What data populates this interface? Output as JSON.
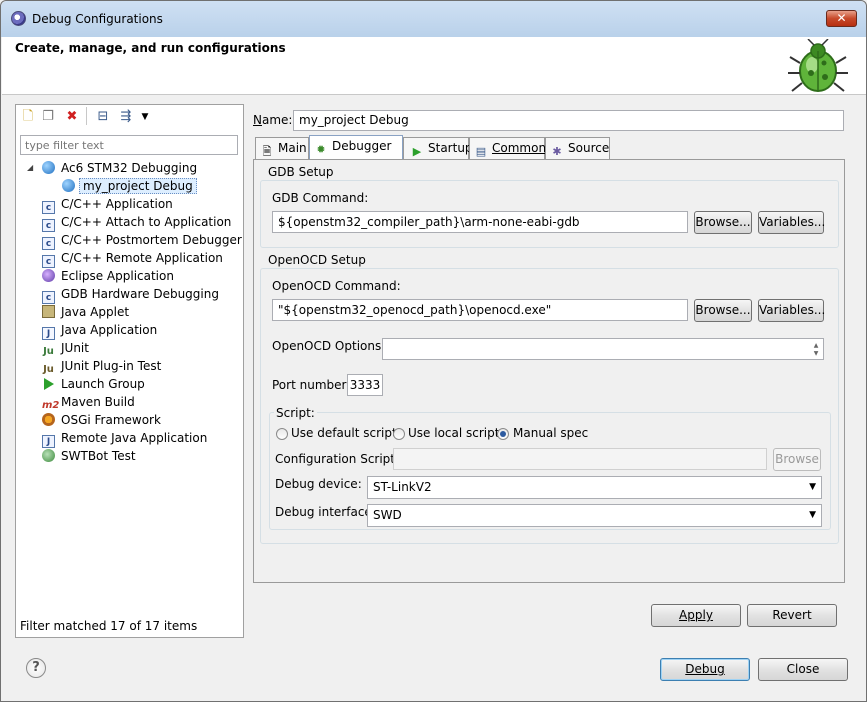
{
  "window": {
    "title": "Debug Configurations",
    "close_glyph": "✕"
  },
  "header": {
    "title": "Create, manage, and run configurations",
    "icon": "bug-icon"
  },
  "left": {
    "toolbar": [
      "new-config-icon",
      "duplicate-icon",
      "delete-icon",
      "collapse-all-icon",
      "filter-icon",
      "dropdown-icon"
    ],
    "filter_placeholder": "type filter text",
    "tree": {
      "root": "Ac6 STM32 Debugging",
      "selected": "my_project Debug",
      "items": [
        {
          "label": "C/C++ Application",
          "icon": "c-app-icon"
        },
        {
          "label": "C/C++ Attach to Application",
          "icon": "c-app-icon"
        },
        {
          "label": "C/C++ Postmortem Debugger",
          "icon": "c-app-icon"
        },
        {
          "label": "C/C++ Remote Application",
          "icon": "c-app-icon"
        },
        {
          "label": "Eclipse Application",
          "icon": "eclipse-icon"
        },
        {
          "label": "GDB Hardware Debugging",
          "icon": "c-app-icon"
        },
        {
          "label": "Java Applet",
          "icon": "applet-icon"
        },
        {
          "label": "Java Application",
          "icon": "java-app-icon"
        },
        {
          "label": "JUnit",
          "icon": "junit-icon"
        },
        {
          "label": "JUnit Plug-in Test",
          "icon": "junit-plugin-icon"
        },
        {
          "label": "Launch Group",
          "icon": "launch-group-icon"
        },
        {
          "label": "Maven Build",
          "icon": "maven-icon"
        },
        {
          "label": "OSGi Framework",
          "icon": "osgi-icon"
        },
        {
          "label": "Remote Java Application",
          "icon": "remote-java-icon"
        },
        {
          "label": "SWTBot Test",
          "icon": "swtbot-icon"
        }
      ]
    },
    "status": "Filter matched 17 of 17 items"
  },
  "right": {
    "name_label_u": "N",
    "name_label_rest": "ame:",
    "name_value": "my_project Debug",
    "tabs": [
      {
        "label": "Main",
        "icon": "main-tab-icon"
      },
      {
        "label": "Debugger",
        "icon": "debugger-tab-icon",
        "active": true
      },
      {
        "label": "Startup",
        "icon": "startup-tab-icon"
      },
      {
        "label": "Common",
        "icon": "common-tab-icon"
      },
      {
        "label": "Source",
        "icon": "source-tab-icon"
      }
    ],
    "gdb": {
      "group_title": "GDB Setup",
      "command_label": "GDB Command:",
      "command_value": "${openstm32_compiler_path}\\arm-none-eabi-gdb",
      "browse": "Browse...",
      "variables": "Variables..."
    },
    "openocd": {
      "group_title": "OpenOCD Setup",
      "command_label": "OpenOCD Command:",
      "command_value": "\"${openstm32_openocd_path}\\openocd.exe\"",
      "browse": "Browse...",
      "variables": "Variables...",
      "options_label": "OpenOCD Options :",
      "options_value": "",
      "port_label": "Port number:",
      "port_value": "3333"
    },
    "script": {
      "group_title": "Script:",
      "radio_default": "Use default script",
      "radio_local": "Use local script",
      "radio_manual": "Manual spec",
      "selected": "manual",
      "config_label": "Configuration Script:",
      "config_value": "",
      "config_browse": "Browse",
      "device_label": "Debug device:",
      "device_value": "ST-LinkV2",
      "interface_label": "Debug interface:",
      "interface_value": "SWD"
    },
    "apply": "Apply",
    "revert": "Revert"
  },
  "footer": {
    "help": "?",
    "debug": "Debug",
    "close": "Close"
  }
}
